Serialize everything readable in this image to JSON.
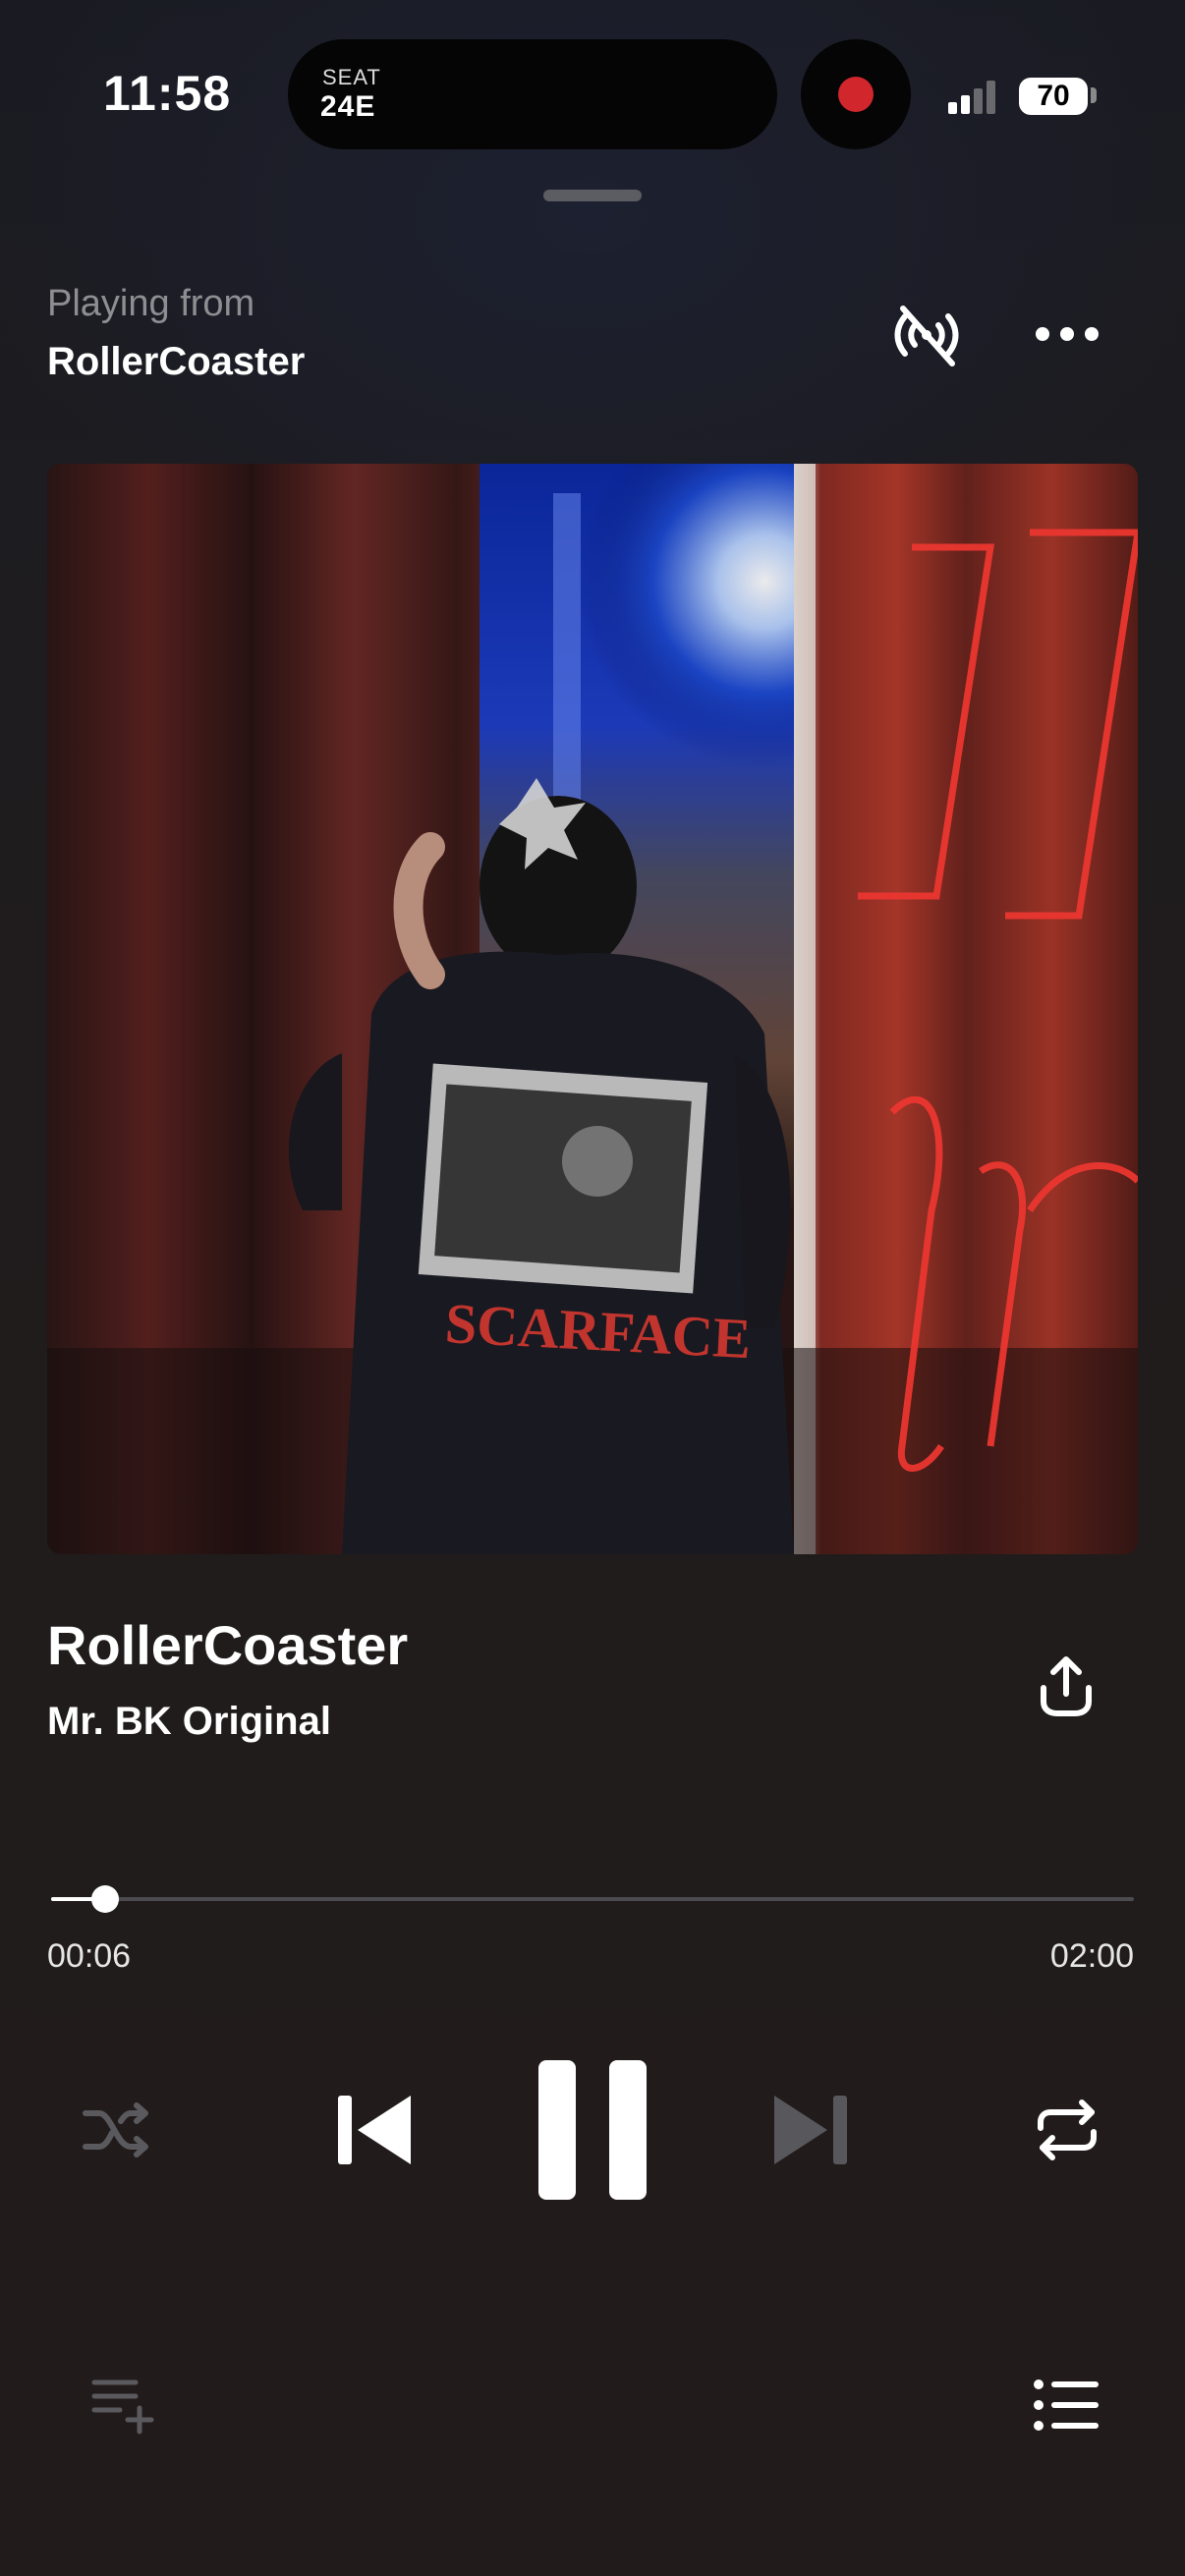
{
  "status_bar": {
    "time": "11:58",
    "island": {
      "seat_label": "SEAT",
      "seat_value": "24E"
    },
    "battery": "70",
    "recording_color": "#d0262c"
  },
  "header": {
    "playing_from_label": "Playing from",
    "source_name": "RollerCoaster",
    "icons": [
      "broadcast-off-icon",
      "more-options-icon"
    ]
  },
  "artwork": {
    "neon_text": "I M lin",
    "shirt_text": "SCARFACE"
  },
  "track": {
    "title": "RollerCoaster",
    "artist": "Mr. BK Original"
  },
  "progress": {
    "elapsed": "00:06",
    "total": "02:00",
    "fraction": 0.05
  },
  "controls": {
    "shuffle": {
      "icon": "shuffle-icon",
      "active": false
    },
    "previous": {
      "icon": "skip-previous-icon"
    },
    "play_pause": {
      "icon": "pause-icon",
      "state": "playing"
    },
    "next": {
      "icon": "skip-next-icon",
      "enabled": false
    },
    "repeat": {
      "icon": "repeat-icon"
    }
  },
  "footer": {
    "left_icon": "add-to-queue-icon",
    "right_icon": "queue-list-icon"
  },
  "colors": {
    "background": "#1f1c1e",
    "accent_text": "#ffffff",
    "muted_text": "#8e8e92",
    "disabled_icon": "#5a5a5e",
    "track_rail": "#4b4b50"
  }
}
